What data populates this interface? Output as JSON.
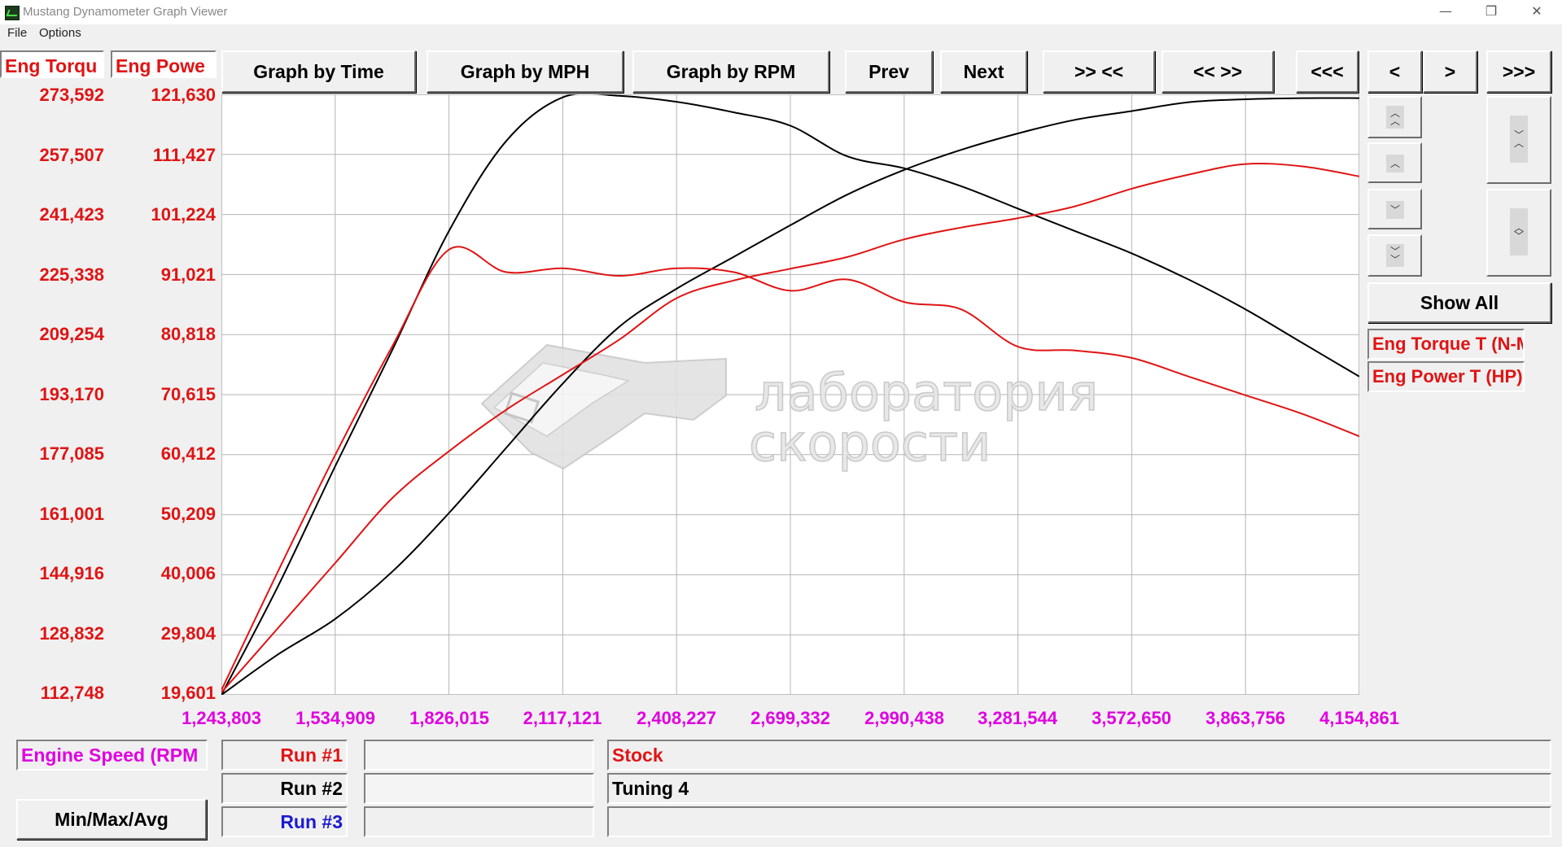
{
  "window": {
    "title": "Mustang Dynamometer Graph Viewer",
    "controls": {
      "minimize": "—",
      "restore": "❐",
      "close": "✕"
    }
  },
  "menu": [
    "File",
    "Options"
  ],
  "axis_headers": {
    "left": "Eng Torqu",
    "right": "Eng Powe"
  },
  "toolbar": {
    "graph_by_time": "Graph by Time",
    "graph_by_mph": "Graph by MPH",
    "graph_by_rpm": "Graph by RPM",
    "prev": "Prev",
    "next": "Next",
    "zoom_in": ">> <<",
    "zoom_out": "<< >>",
    "first": "<<<",
    "step_back": "<",
    "step_forward": ">",
    "last": ">>>"
  },
  "side_panel": {
    "show_all": "Show All",
    "legend": [
      {
        "label": "Eng Torque T (N-M",
        "color": "#e01414"
      },
      {
        "label": "Eng Power T (HP)",
        "color": "#e01414"
      }
    ]
  },
  "x_axis_selector": "Engine Speed (RPM",
  "min_max_avg": "Min/Max/Avg",
  "runs": [
    {
      "label": "Run #1",
      "label_color": "#e01414",
      "name": "Stock",
      "name_color": "#e01414"
    },
    {
      "label": "Run #2",
      "label_color": "#000000",
      "name": "Tuning 4",
      "name_color": "#000000"
    },
    {
      "label": "Run #3",
      "label_color": "#1a1ad0",
      "name": "",
      "name_color": "#000000"
    }
  ],
  "watermark": {
    "line1": "лаборатория",
    "line2": "скорости"
  },
  "chart_data": {
    "type": "line",
    "xlabel": "Engine Speed (RPM",
    "x_ticks": [
      "1,243,803",
      "1,534,909",
      "1,826,015",
      "2,117,121",
      "2,408,227",
      "2,699,332",
      "2,990,438",
      "3,281,544",
      "3,572,650",
      "3,863,756",
      "4,154,861"
    ],
    "xlim": [
      1243803,
      4154861
    ],
    "y_left": {
      "label": "Eng Torqu",
      "ticks": [
        "273,592",
        "257,507",
        "241,423",
        "225,338",
        "209,254",
        "193,170",
        "177,085",
        "161,001",
        "144,916",
        "128,832",
        "112,748"
      ],
      "ylim": [
        112748,
        273592
      ]
    },
    "y_right": {
      "label": "Eng Powe",
      "ticks": [
        "121,630",
        "111,427",
        "101,224",
        "91,021",
        "80,818",
        "70,615",
        "60,412",
        "50,209",
        "40,006",
        "29,804",
        "19,601"
      ],
      "ylim": [
        19601,
        121630
      ]
    },
    "grid": true,
    "series": [
      {
        "name": "Eng Torque T (N-M",
        "run": "Run #2",
        "color": "#000000",
        "axis": "left",
        "x": [
          1243803,
          1389356,
          1534909,
          1680462,
          1826015,
          1971568,
          2117121,
          2262674,
          2408227,
          2553780,
          2699332,
          2844885,
          2990438,
          3135991,
          3281544,
          3427097,
          3572650,
          3718203,
          3863756,
          4009309,
          4154861
        ],
        "y": [
          112748,
          142000,
          174000,
          205000,
          237000,
          261000,
          272800,
          273200,
          271600,
          268800,
          265200,
          257000,
          253800,
          249000,
          243000,
          237000,
          231000,
          224000,
          216000,
          207000,
          198000
        ]
      },
      {
        "name": "Eng Power T (HP)",
        "run": "Run #2",
        "color": "#000000",
        "axis": "right",
        "x": [
          1243803,
          1389356,
          1534909,
          1680462,
          1826015,
          1971568,
          2117121,
          2262674,
          2408227,
          2553780,
          2699332,
          2844885,
          2990438,
          3135991,
          3281544,
          3427097,
          3572650,
          3718203,
          3863756,
          4009309,
          4154861
        ],
        "y": [
          19601,
          26500,
          32500,
          40500,
          50500,
          61500,
          72500,
          82200,
          88600,
          94000,
          99400,
          104600,
          108800,
          112200,
          115000,
          117300,
          118800,
          120300,
          120800,
          121000,
          121000
        ]
      },
      {
        "name": "Eng Torque T (N-M",
        "run": "Run #1",
        "color": "#e01414",
        "axis": "left",
        "x": [
          1243803,
          1389356,
          1534909,
          1680462,
          1826015,
          1971568,
          2117121,
          2262674,
          2408227,
          2553780,
          2699332,
          2844885,
          2990438,
          3135991,
          3281544,
          3427097,
          3572650,
          3718203,
          3863756,
          4009309,
          4154861
        ],
        "y": [
          114000,
          146000,
          177000,
          206000,
          232000,
          226000,
          227000,
          225000,
          227000,
          226000,
          221000,
          224000,
          218000,
          216000,
          206000,
          205000,
          203000,
          198000,
          193000,
          188000,
          182000
        ]
      },
      {
        "name": "Eng Power T (HP)",
        "run": "Run #1",
        "color": "#e01414",
        "axis": "right",
        "x": [
          1243803,
          1389356,
          1534909,
          1680462,
          1826015,
          1971568,
          2117121,
          2262674,
          2408227,
          2553780,
          2699332,
          2844885,
          2990438,
          3135991,
          3281544,
          3427097,
          3572650,
          3718203,
          3863756,
          4009309,
          4154861
        ],
        "y": [
          20000,
          31000,
          42000,
          53000,
          61000,
          68000,
          74000,
          80000,
          87000,
          90000,
          92000,
          94000,
          97000,
          99000,
          100600,
          102600,
          105600,
          108000,
          109800,
          109400,
          107700
        ]
      }
    ]
  }
}
